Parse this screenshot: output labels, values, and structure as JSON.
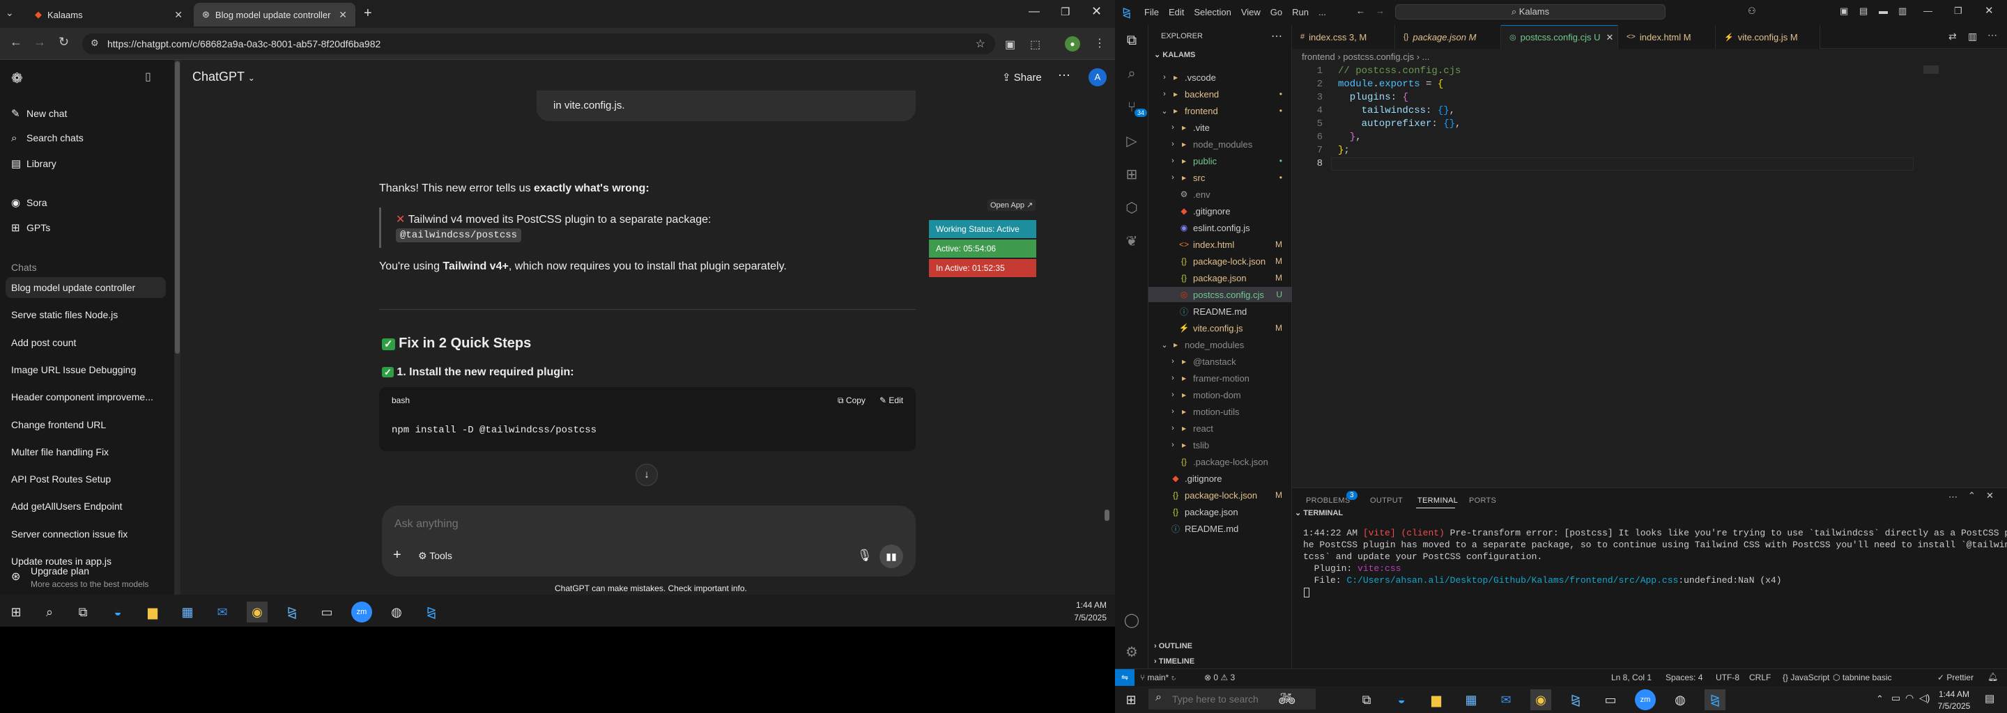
{
  "chrome": {
    "tabs": [
      {
        "label": "Kalaams",
        "active": false
      },
      {
        "label": "Blog model update controller",
        "active": true
      }
    ],
    "new_tab": "+",
    "url": "https://chatgpt.com/c/68682a9a-0a3c-8001-ab57-8f20df6ba982"
  },
  "gpt": {
    "sidebar": {
      "new_chat": "New chat",
      "search_chats": "Search chats",
      "library": "Library",
      "sora": "Sora",
      "gpts": "GPTs",
      "chats_heading": "Chats",
      "chats": [
        "Blog model update controller",
        "Serve static files Node.js",
        "Add post count",
        "Image URL Issue Debugging",
        "Header component improveme...",
        "Change frontend URL",
        "Multer file handling Fix",
        "API Post Routes Setup",
        "Add getAllUsers Endpoint",
        "Server connection issue fix",
        "Update routes in app.js"
      ],
      "upgrade_title": "Upgrade plan",
      "upgrade_sub": "More access to the best models"
    },
    "header": {
      "model": "ChatGPT",
      "share": "Share",
      "avatar": "A"
    },
    "messages": {
      "prev_tail": "in vite.config.js.",
      "intro_pre": "Thanks! This new error tells us ",
      "intro_bold": "exactly what's wrong:",
      "quote_line": "Tailwind v4 moved its PostCSS plugin to a separate package:",
      "quote_code": "@tailwindcss/postcss",
      "using_pre": "You're using ",
      "using_bold": "Tailwind v4+",
      "using_post": ", which now requires you to install that plugin separately.",
      "fix_heading": "Fix in 2 Quick Steps",
      "step1": "1. Install the new required plugin:",
      "code_lang": "bash",
      "copy": "Copy",
      "edit": "Edit",
      "code": "npm install -D @tailwindcss/postcss"
    },
    "composer": {
      "placeholder": "Ask anything",
      "tools": "Tools"
    },
    "disclaimer": "ChatGPT can make mistakes. Check important info.",
    "overlay": {
      "open_app": "Open App",
      "status": "Working Status: Active",
      "active": "Active: 05:54:06",
      "inactive": "In Active: 01:52:35"
    }
  },
  "taskbar1": {
    "time": "1:44 AM",
    "date": "7/5/2025"
  },
  "vscode": {
    "menu": [
      "File",
      "Edit",
      "Selection",
      "View",
      "Go",
      "Run",
      "..."
    ],
    "search": "Kalams",
    "explorer_title": "EXPLORER",
    "root": "KALAMS",
    "tree": [
      {
        "name": ".vscode",
        "depth": 1,
        "chev": "›",
        "icon": "folder",
        "color": "#cccccc",
        "badge": ""
      },
      {
        "name": "backend",
        "depth": 1,
        "chev": "›",
        "icon": "folder",
        "color": "#e2c08d",
        "badge": "•"
      },
      {
        "name": "frontend",
        "depth": 1,
        "chev": "⌄",
        "icon": "folder",
        "color": "#e2c08d",
        "badge": "•"
      },
      {
        "name": ".vite",
        "depth": 2,
        "chev": "›",
        "icon": "folder",
        "color": "#cccccc",
        "badge": ""
      },
      {
        "name": "node_modules",
        "depth": 2,
        "chev": "›",
        "icon": "folder",
        "color": "#8c8c8c",
        "badge": ""
      },
      {
        "name": "public",
        "depth": 2,
        "chev": "›",
        "icon": "folder",
        "color": "#73c991",
        "badge": "•"
      },
      {
        "name": "src",
        "depth": 2,
        "chev": "›",
        "icon": "folder",
        "color": "#e2c08d",
        "badge": "•"
      },
      {
        "name": ".env",
        "depth": 2,
        "chev": "",
        "icon": "env",
        "color": "#8c8c8c",
        "badge": ""
      },
      {
        "name": ".gitignore",
        "depth": 2,
        "chev": "",
        "icon": "git",
        "color": "#cccccc",
        "badge": ""
      },
      {
        "name": "eslint.config.js",
        "depth": 2,
        "chev": "",
        "icon": "eslint",
        "color": "#cccccc",
        "badge": ""
      },
      {
        "name": "index.html",
        "depth": 2,
        "chev": "",
        "icon": "html",
        "color": "#e2c08d",
        "badge": "M"
      },
      {
        "name": "package-lock.json",
        "depth": 2,
        "chev": "",
        "icon": "json",
        "color": "#e2c08d",
        "badge": "M"
      },
      {
        "name": "package.json",
        "depth": 2,
        "chev": "",
        "icon": "json",
        "color": "#e2c08d",
        "badge": "M"
      },
      {
        "name": "postcss.config.cjs",
        "depth": 2,
        "chev": "",
        "icon": "postcss",
        "color": "#73c991",
        "badge": "U",
        "selected": true
      },
      {
        "name": "README.md",
        "depth": 2,
        "chev": "",
        "icon": "md",
        "color": "#cccccc",
        "badge": ""
      },
      {
        "name": "vite.config.js",
        "depth": 2,
        "chev": "",
        "icon": "vite",
        "color": "#e2c08d",
        "badge": "M"
      },
      {
        "name": "node_modules",
        "depth": 1,
        "chev": "⌄",
        "icon": "folder",
        "color": "#8c8c8c",
        "badge": ""
      },
      {
        "name": "@tanstack",
        "depth": 2,
        "chev": "›",
        "icon": "folder",
        "color": "#8c8c8c",
        "badge": ""
      },
      {
        "name": "framer-motion",
        "depth": 2,
        "chev": "›",
        "icon": "folder",
        "color": "#8c8c8c",
        "badge": ""
      },
      {
        "name": "motion-dom",
        "depth": 2,
        "chev": "›",
        "icon": "folder",
        "color": "#8c8c8c",
        "badge": ""
      },
      {
        "name": "motion-utils",
        "depth": 2,
        "chev": "›",
        "icon": "folder",
        "color": "#8c8c8c",
        "badge": ""
      },
      {
        "name": "react",
        "depth": 2,
        "chev": "›",
        "icon": "folder",
        "color": "#8c8c8c",
        "badge": ""
      },
      {
        "name": "tslib",
        "depth": 2,
        "chev": "›",
        "icon": "folder",
        "color": "#8c8c8c",
        "badge": ""
      },
      {
        "name": ".package-lock.json",
        "depth": 2,
        "chev": "",
        "icon": "json",
        "color": "#8c8c8c",
        "badge": ""
      },
      {
        "name": ".gitignore",
        "depth": 1,
        "chev": "",
        "icon": "git",
        "color": "#cccccc",
        "badge": ""
      },
      {
        "name": "package-lock.json",
        "depth": 1,
        "chev": "",
        "icon": "json",
        "color": "#e2c08d",
        "badge": "M"
      },
      {
        "name": "package.json",
        "depth": 1,
        "chev": "",
        "icon": "json",
        "color": "#cccccc",
        "badge": ""
      },
      {
        "name": "README.md",
        "depth": 1,
        "chev": "",
        "icon": "md",
        "color": "#cccccc",
        "badge": ""
      }
    ],
    "outline": "OUTLINE",
    "timeline": "TIMELINE",
    "tabs": [
      {
        "label": "index.css 3, M",
        "color": "#e2c08d",
        "icon": "#",
        "active": false
      },
      {
        "label": "package.json M",
        "color": "#e2c08d",
        "icon": "{}",
        "active": false
      },
      {
        "label": "postcss.config.cjs U",
        "color": "#73c991",
        "icon": "◎",
        "active": true
      },
      {
        "label": "index.html M",
        "color": "#e2c08d",
        "icon": "<>",
        "active": false
      },
      {
        "label": "vite.config.js M",
        "color": "#e2c08d",
        "icon": "⚡",
        "active": false
      }
    ],
    "breadcrumb": "frontend › postcss.config.cjs › ...",
    "code_lines": [
      [
        {
          "t": "// postcss.config.cjs",
          "c": "#6a9955"
        }
      ],
      [
        {
          "t": "module",
          "c": "#4fc1ff"
        },
        {
          "t": ".",
          "c": "#cccccc"
        },
        {
          "t": "exports",
          "c": "#4fc1ff"
        },
        {
          "t": " = ",
          "c": "#d4d4d4"
        },
        {
          "t": "{",
          "c": "#ffd700"
        }
      ],
      [
        {
          "t": "  plugins",
          "c": "#9cdcfe"
        },
        {
          "t": ": ",
          "c": "#cccccc"
        },
        {
          "t": "{",
          "c": "#da70d6"
        }
      ],
      [
        {
          "t": "    tailwindcss",
          "c": "#9cdcfe"
        },
        {
          "t": ": ",
          "c": "#cccccc"
        },
        {
          "t": "{}",
          "c": "#179fff"
        },
        {
          "t": ",",
          "c": "#cccccc"
        }
      ],
      [
        {
          "t": "    autoprefixer",
          "c": "#9cdcfe"
        },
        {
          "t": ": ",
          "c": "#cccccc"
        },
        {
          "t": "{}",
          "c": "#179fff"
        },
        {
          "t": ",",
          "c": "#cccccc"
        }
      ],
      [
        {
          "t": "  }",
          "c": "#da70d6"
        },
        {
          "t": ",",
          "c": "#cccccc"
        }
      ],
      [
        {
          "t": "}",
          "c": "#ffd700"
        },
        {
          "t": ";",
          "c": "#cccccc"
        }
      ],
      [
        {
          "t": "",
          "c": "#cccccc"
        }
      ]
    ],
    "panel_tabs": [
      "PROBLEMS",
      "OUTPUT",
      "TERMINAL",
      "PORTS"
    ],
    "problems_count": "3",
    "terminal_label": "TERMINAL",
    "terminal_lines": [
      [
        {
          "t": "1:44:22 AM ",
          "c": "#cccccc"
        },
        {
          "t": "[vite]",
          "c": "#f14c4c"
        },
        {
          "t": " (client) ",
          "c": "#f14c4c"
        },
        {
          "t": "Pre-transform error: [postcss] It looks like you're trying to use `tailwindcss` directly as a PostCSS plugin. T",
          "c": "#cccccc"
        }
      ],
      [
        {
          "t": "he PostCSS plugin has moved to a separate package, so to continue using Tailwind CSS with PostCSS you'll need to install `@tailwindcss/pos",
          "c": "#cccccc"
        }
      ],
      [
        {
          "t": "tcss` and update your PostCSS configuration.",
          "c": "#cccccc"
        }
      ],
      [
        {
          "t": "  Plugin: ",
          "c": "#cccccc"
        },
        {
          "t": "vite:css",
          "c": "#bc3fbc"
        }
      ],
      [
        {
          "t": "  File: ",
          "c": "#cccccc"
        },
        {
          "t": "C:/Users/ahsan.ali/Desktop/Github/Kalams/frontend/src/App.css",
          "c": "#11a8cd"
        },
        {
          "t": ":undefined:NaN (x4)",
          "c": "#cccccc"
        }
      ]
    ],
    "status": {
      "branch": "main*",
      "problems": "⊗ 0 ⚠ 3",
      "position": "Ln 8, Col 1",
      "spaces": "Spaces: 4",
      "encoding": "UTF-8",
      "eol": "CRLF",
      "language": "{} JavaScript",
      "tabnine": "tabnine basic",
      "prettier": "✓ Prettier"
    }
  },
  "taskbar2": {
    "search_placeholder": "Type here to search",
    "time": "1:44 AM",
    "date": "7/5/2025"
  }
}
